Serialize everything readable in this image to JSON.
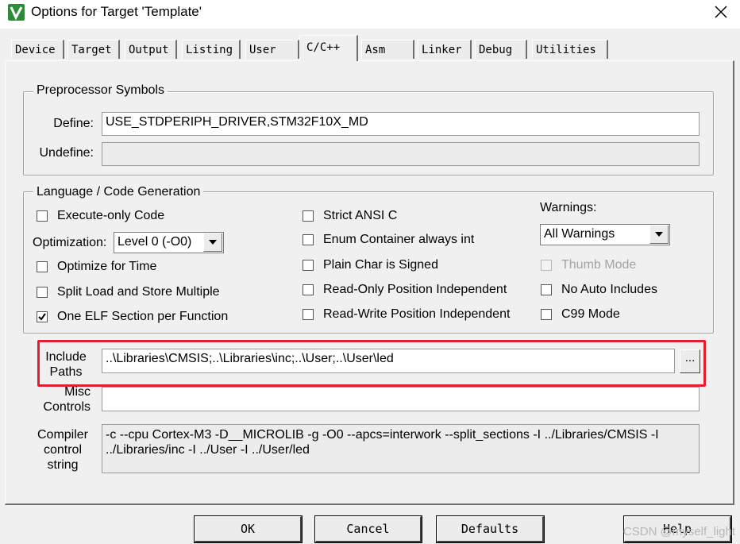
{
  "window": {
    "title": "Options for Target 'Template'",
    "icon": "keil-uvision-icon"
  },
  "tabs": [
    "Device",
    "Target",
    "Output",
    "Listing",
    "User",
    "C/C++",
    "Asm",
    "Linker",
    "Debug",
    "Utilities"
  ],
  "active_tab": "C/C++",
  "preprocessor": {
    "group_title": "Preprocessor Symbols",
    "define_label": "Define:",
    "define_value": "USE_STDPERIPH_DRIVER,STM32F10X_MD",
    "undefine_label": "Undefine:",
    "undefine_value": ""
  },
  "codegen": {
    "group_title": "Language / Code Generation",
    "execute_only": {
      "label": "Execute-only Code",
      "checked": false
    },
    "optimization_label": "Optimization:",
    "optimization_value": "Level 0 (-O0)",
    "optimize_time": {
      "label": "Optimize for Time",
      "checked": false
    },
    "split_load": {
      "label": "Split Load and Store Multiple",
      "checked": false
    },
    "one_elf": {
      "label": "One ELF Section per Function",
      "checked": true
    },
    "strict_ansi": {
      "label": "Strict ANSI C",
      "checked": false
    },
    "enum_container": {
      "label": "Enum Container always int",
      "checked": false
    },
    "plain_char": {
      "label": "Plain Char is Signed",
      "checked": false
    },
    "ro_pos": {
      "label": "Read-Only Position Independent",
      "checked": false
    },
    "rw_pos": {
      "label": "Read-Write Position Independent",
      "checked": false
    },
    "warnings_label": "Warnings:",
    "warnings_value": "All Warnings",
    "thumb_mode": {
      "label": "Thumb Mode",
      "checked": false,
      "disabled": true
    },
    "no_auto_includes": {
      "label": "No Auto Includes",
      "checked": false
    },
    "c99_mode": {
      "label": "C99 Mode",
      "checked": false
    }
  },
  "include": {
    "label_line1": "Include",
    "label_line2": "Paths",
    "value": "..\\Libraries\\CMSIS;..\\Libraries\\inc;..\\User;..\\User\\led",
    "browse_label": "...",
    "highlight_color": "#e0202a"
  },
  "misc": {
    "label_line1": "Misc",
    "label_line2": "Controls",
    "value": ""
  },
  "compiler": {
    "label_line1": "Compiler",
    "label_line2": "control",
    "label_line3": "string",
    "line1": "-c --cpu Cortex-M3 -D__MICROLIB -g -O0 --apcs=interwork --split_sections -I ../Libraries/CMSIS -I",
    "line2": "../Libraries/inc -I ../User -I ../User/led"
  },
  "buttons": {
    "ok": "OK",
    "cancel": "Cancel",
    "defaults": "Defaults",
    "help": "Help"
  },
  "watermark": "CSDN @myself_light"
}
